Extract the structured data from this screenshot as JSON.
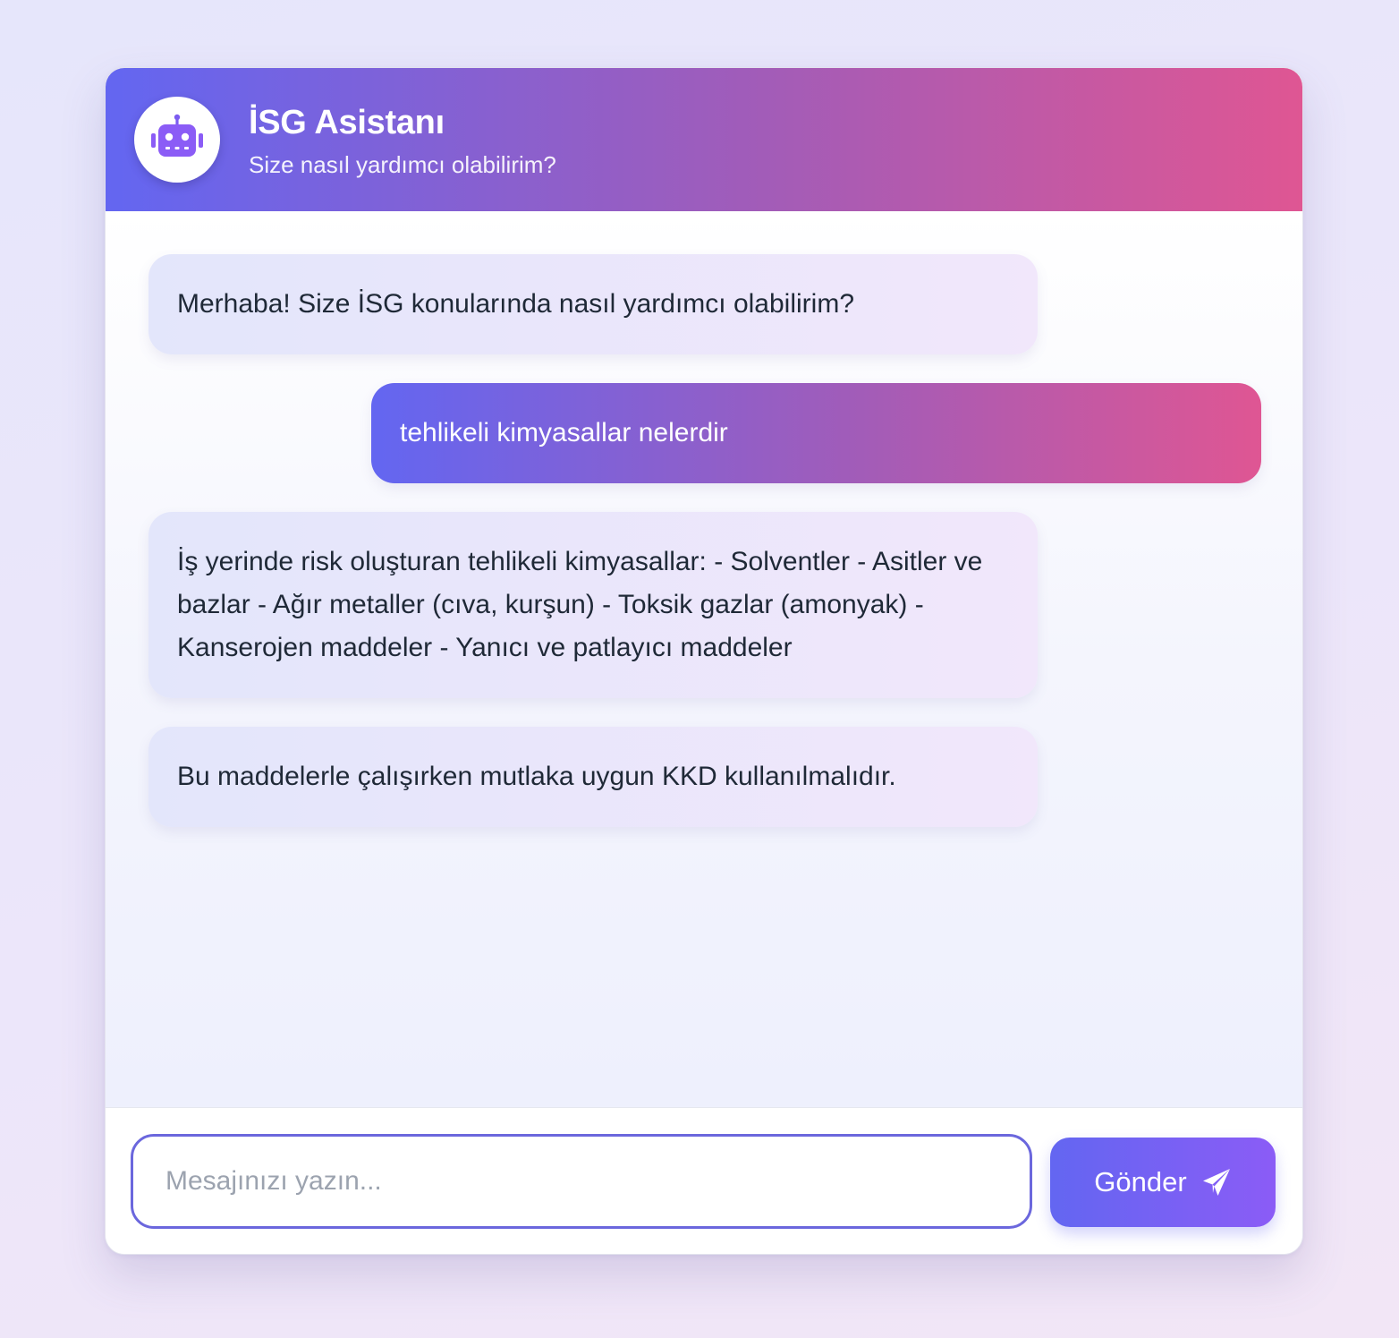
{
  "header": {
    "title": "İSG Asistanı",
    "subtitle": "Size nasıl yardımcı olabilirim?",
    "avatar_icon": "robot-icon"
  },
  "messages": [
    {
      "role": "bot",
      "text": "Merhaba! Size İSG konularında nasıl yardımcı olabilirim?"
    },
    {
      "role": "user",
      "text": "tehlikeli kimyasallar nelerdir"
    },
    {
      "role": "bot",
      "text": "İş yerinde risk oluşturan tehlikeli kimyasallar: - Solventler - Asitler ve bazlar - Ağır metaller (cıva, kurşun) - Toksik gazlar (amonyak) - Kanserojen maddeler - Yanıcı ve patlayıcı maddeler"
    },
    {
      "role": "bot",
      "text": "Bu maddelerle çalışırken mutlaka uygun KKD kullanılmalıdır."
    }
  ],
  "input": {
    "placeholder": "Mesajınızı yazın...",
    "value": ""
  },
  "send_button": {
    "label": "Gönder",
    "icon": "paper-plane-icon"
  },
  "colors": {
    "gradient_start": "#6366f1",
    "gradient_mid": "#a25cb8",
    "gradient_end": "#df5693",
    "button_end": "#8b5cf6",
    "input_border": "#6b67dd"
  }
}
